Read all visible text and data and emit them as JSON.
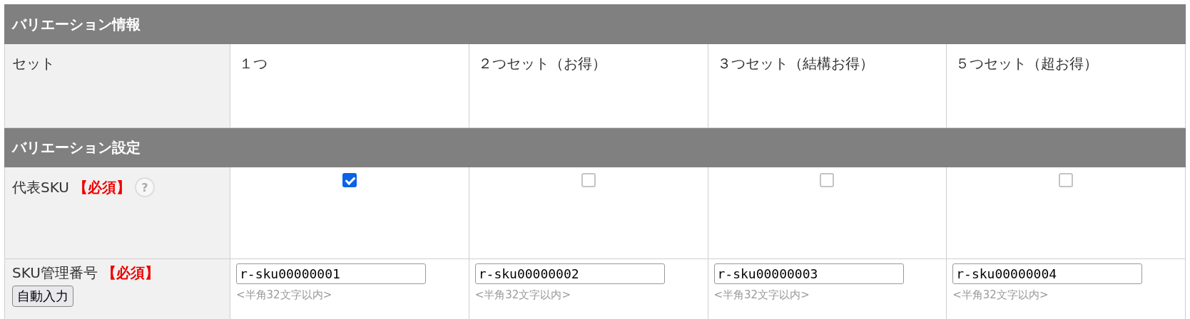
{
  "sections": [
    {
      "title": "バリエーション情報",
      "rows": [
        {
          "kind": "text",
          "label": "セット",
          "cells": [
            "１つ",
            "２つセット（お得）",
            "３つセット（結構お得）",
            "５つセット（超お得）"
          ]
        }
      ]
    },
    {
      "title": "バリエーション設定",
      "rows": [
        {
          "kind": "checkbox",
          "label": "代表SKU",
          "required": "【必須】",
          "help": "?",
          "cells": [
            {
              "checked": true
            },
            {
              "checked": false
            },
            {
              "checked": false
            },
            {
              "checked": false
            }
          ]
        },
        {
          "kind": "input",
          "label": "SKU管理番号",
          "required": "【必須】",
          "button": "自動入力",
          "cells": [
            {
              "value": "r-sku00000001",
              "note": "<半角32文字以内>"
            },
            {
              "value": "r-sku00000002",
              "note": "<半角32文字以内>"
            },
            {
              "value": "r-sku00000003",
              "note": "<半角32文字以内>"
            },
            {
              "value": "r-sku00000004",
              "note": "<半角32文字以内>"
            }
          ]
        }
      ]
    }
  ]
}
